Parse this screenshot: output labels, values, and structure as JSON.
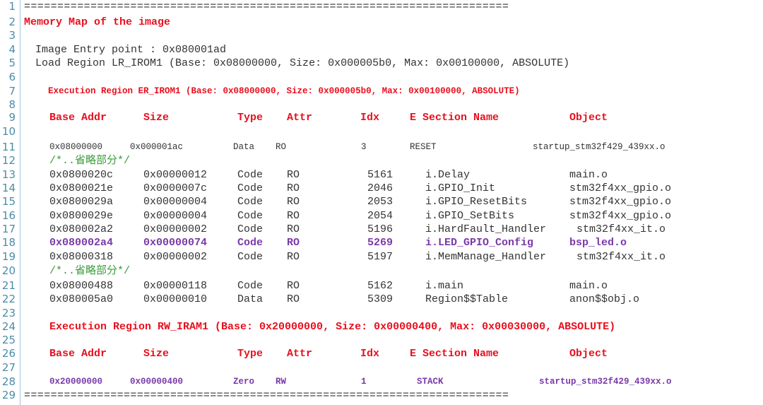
{
  "line_numbers": [
    "1",
    "2",
    "3",
    "4",
    "5",
    "6",
    "7",
    "8",
    "9",
    "10",
    "11",
    "12",
    "13",
    "14",
    "15",
    "16",
    "17",
    "18",
    "19",
    "20",
    "21",
    "22",
    "23",
    "24",
    "25",
    "26",
    "27",
    "28",
    "29"
  ],
  "separator": "=========================================================================",
  "title": "Memory Map of the image",
  "entry_point": "Image Entry point : 0x080001ad",
  "load_region": "Load Region LR_IROM1 (Base: 0x08000000, Size: 0x000005b0, Max: 0x00100000, ABSOLUTE)",
  "exec_region_1": "Execution Region ER_IROM1 (Base: 0x08000000, Size: 0x000005b0, Max: 0x00100000, ABSOLUTE)",
  "exec_region_2": "Execution Region RW_IRAM1 (Base: 0x20000000, Size: 0x00000400, Max: 0x00030000, ABSOLUTE)",
  "omitted_comment": "/*..省略部分*/",
  "headers": [
    "Base Addr",
    "Size",
    "Type",
    "Attr",
    "Idx",
    "E Section Name",
    "Object"
  ],
  "reset_row": [
    "0x08000000",
    "0x000001ac",
    "Data",
    "RO",
    "3",
    "RESET",
    "startup_stm32f429_439xx.o"
  ],
  "rows_a": [
    [
      "0x0800020c",
      "0x00000012",
      "Code",
      "RO",
      "5161",
      "i.Delay",
      "main.o"
    ],
    [
      "0x0800021e",
      "0x0000007c",
      "Code",
      "RO",
      "2046",
      "i.GPIO_Init",
      "stm32f4xx_gpio.o"
    ],
    [
      "0x0800029a",
      "0x00000004",
      "Code",
      "RO",
      "2053",
      "i.GPIO_ResetBits",
      "stm32f4xx_gpio.o"
    ],
    [
      "0x0800029e",
      "0x00000004",
      "Code",
      "RO",
      "2054",
      "i.GPIO_SetBits",
      "stm32f4xx_gpio.o"
    ],
    [
      "0x080002a2",
      "0x00000002",
      "Code",
      "RO",
      "5196",
      "i.HardFault_Handler",
      "stm32f4xx_it.o"
    ],
    [
      "0x080002a4",
      "0x00000074",
      "Code",
      "RO",
      "5269",
      "i.LED_GPIO_Config",
      "bsp_led.o"
    ],
    [
      "0x08000318",
      "0x00000002",
      "Code",
      "RO",
      "5197",
      "i.MemManage_Handler",
      "stm32f4xx_it.o"
    ]
  ],
  "rows_b": [
    [
      "0x08000488",
      "0x00000118",
      "Code",
      "RO",
      "5162",
      "i.main",
      "main.o"
    ],
    [
      "0x080005a0",
      "0x00000010",
      "Data",
      "RO",
      "5309",
      "Region$$Table",
      "anon$$obj.o"
    ]
  ],
  "stack_row": [
    "0x20000000",
    "0x00000400",
    "Zero",
    "RW",
    "1",
    "STACK",
    "startup_stm32f429_439xx.o"
  ],
  "colors": {
    "keyword_red": "#e8101e",
    "highlight_purple": "#7a3aa8",
    "comment_green": "#3a9a3a",
    "line_number": "#4a8ca8"
  }
}
